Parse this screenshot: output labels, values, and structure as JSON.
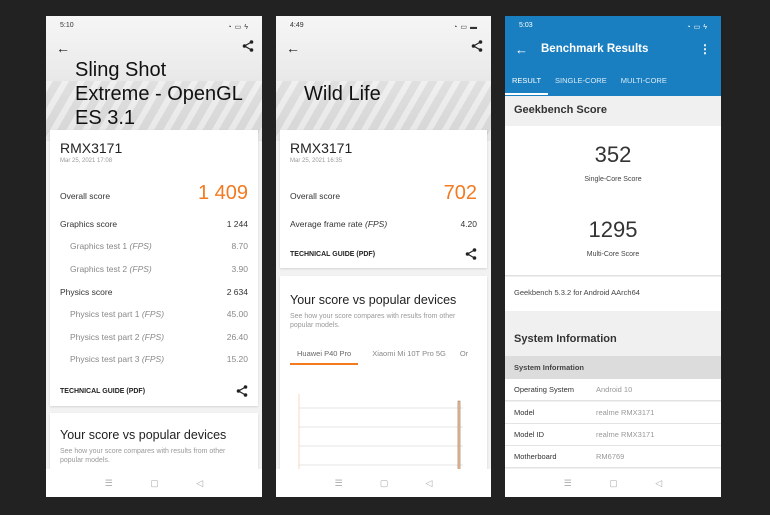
{
  "screens": {
    "sling_shot": {
      "status_time": "5:10",
      "title_lines": [
        "Sling Shot",
        "Extreme - OpenGL",
        "ES 3.1"
      ],
      "device": "RMX3171",
      "date": "Mar 25, 2021 17:08",
      "overall_label": "Overall score",
      "overall_value": "1 409",
      "rows": [
        {
          "label": "Graphics score",
          "value": "1 244",
          "sub": false
        },
        {
          "label": "Graphics test 1",
          "unit": "(FPS)",
          "value": "8.70",
          "sub": true
        },
        {
          "label": "Graphics test 2",
          "unit": "(FPS)",
          "value": "3.90",
          "sub": true
        },
        {
          "label": "Physics score",
          "value": "2 634",
          "sub": false
        },
        {
          "label": "Physics test part 1",
          "unit": "(FPS)",
          "value": "45.00",
          "sub": true
        },
        {
          "label": "Physics test part 2",
          "unit": "(FPS)",
          "value": "26.40",
          "sub": true
        },
        {
          "label": "Physics test part 3",
          "unit": "(FPS)",
          "value": "15.20",
          "sub": true
        }
      ],
      "technical_guide": "TECHNICAL GUIDE (PDF)",
      "vs_title": "Your score vs popular devices",
      "vs_desc": "See how your score compares with results from other popular models."
    },
    "wild_life": {
      "status_time": "4:49",
      "title": "Wild Life",
      "device": "RMX3171",
      "date": "Mar 25, 2021 16:35",
      "overall_label": "Overall score",
      "overall_value": "702",
      "fps_label": "Average frame rate",
      "fps_unit": "(FPS)",
      "fps_value": "4.20",
      "technical_guide": "TECHNICAL GUIDE (PDF)",
      "vs_title": "Your score vs popular devices",
      "vs_desc": "See how your score compares with results from other popular models.",
      "device_tabs": [
        "Huawei P40 Pro",
        "Xiaomi Mi 10T Pro 5G",
        "Or"
      ]
    },
    "geekbench": {
      "status_time": "5:03",
      "title": "Benchmark Results",
      "tabs": [
        "RESULT",
        "SINGLE-CORE",
        "MULTI-CORE"
      ],
      "score_section": "Geekbench Score",
      "single_core_score": "352",
      "single_core_label": "Single-Core Score",
      "multi_core_score": "1295",
      "multi_core_label": "Multi-Core Score",
      "version": "Geekbench 5.3.2 for Android AArch64",
      "sysinfo_section": "System Information",
      "sysinfo_header": "System Information",
      "sysinfo": [
        {
          "key": "Operating System",
          "value": "Android 10"
        },
        {
          "key": "Model",
          "value": "realme RMX3171"
        },
        {
          "key": "Model ID",
          "value": "realme RMX3171"
        },
        {
          "key": "Motherboard",
          "value": "RM6769"
        }
      ]
    }
  },
  "colors": {
    "accent_orange": "#f47a20",
    "geekbench_blue": "#1a7fc1"
  },
  "nav_icons": [
    "menu-icon",
    "home-icon",
    "back-icon"
  ]
}
